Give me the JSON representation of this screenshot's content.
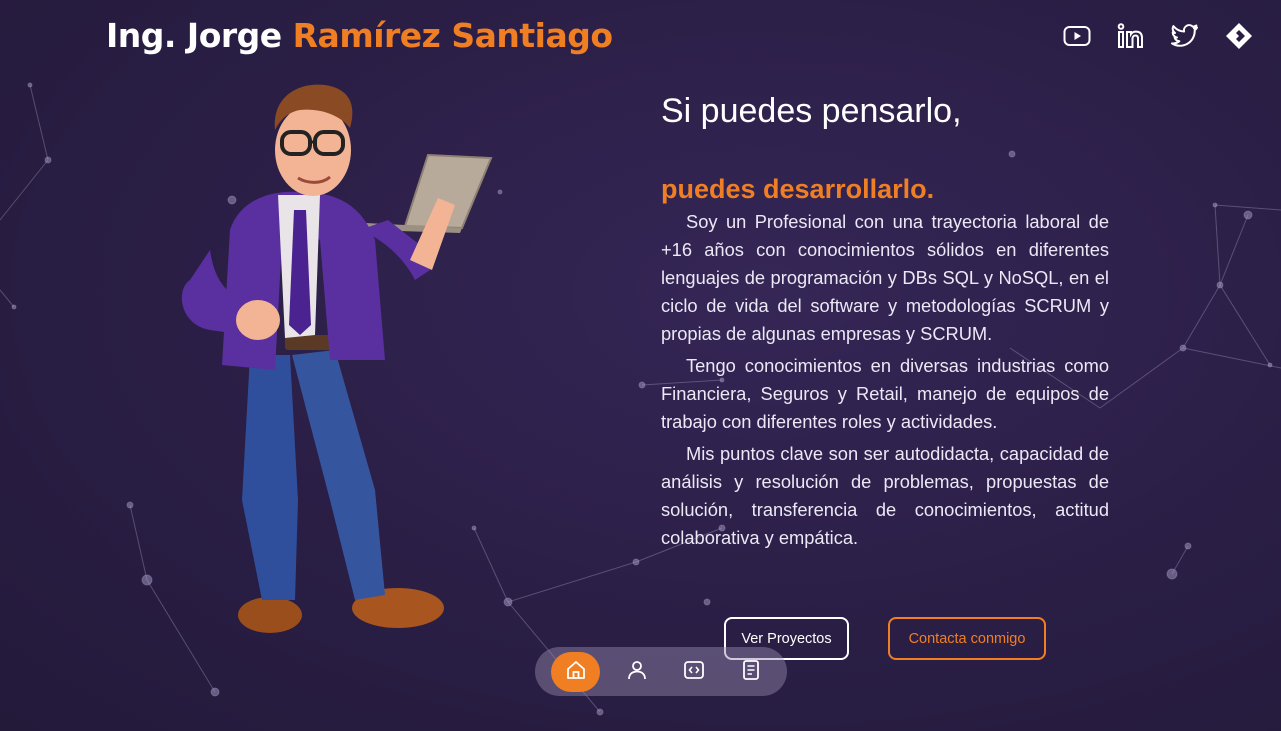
{
  "header": {
    "prefix": "Ing. Jorge ",
    "name_highlight": "Ramírez Santiago"
  },
  "socials": [
    "youtube-icon",
    "linkedin-icon",
    "twitter-icon",
    "brand-logo-icon"
  ],
  "hero": {
    "headline_line1": "Si puedes pensarlo,",
    "headline_line2": "puedes desarrollarlo.",
    "bio": [
      "Soy un Profesional con una trayectoria laboral de +16 años con conocimientos sólidos en diferentes lenguajes de programación y DBs SQL y NoSQL, en el ciclo de vida del software y metodologías SCRUM y propias de algunas empresas y SCRUM.",
      "Tengo conocimientos en diversas industrias como Financiera, Seguros y Retail, manejo de equipos de trabajo con diferentes roles y actividades.",
      "Mis puntos clave son ser autodidacta, capacidad de análisis y resolución de problemas, propuestas de solución, transferencia de conocimientos, actitud colaborativa y empática."
    ],
    "btn_projects": "Ver Proyectos",
    "btn_contact": "Contacta conmigo"
  },
  "dock": {
    "items": [
      "home-icon",
      "user-icon",
      "code-icon",
      "document-icon"
    ],
    "active": "home-icon"
  },
  "colors": {
    "accent": "#f07f24",
    "background": "#2a1e45",
    "text": "#ffffff"
  }
}
